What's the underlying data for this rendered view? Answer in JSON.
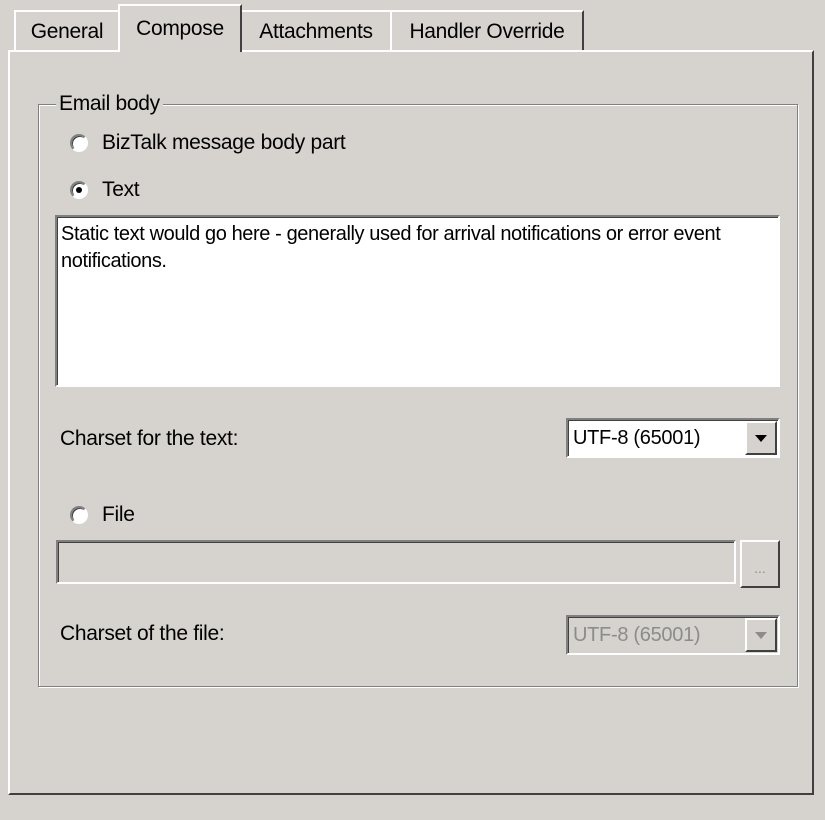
{
  "tabs": [
    "General",
    "Compose",
    "Attachments",
    "Handler Override"
  ],
  "active_tab": "Compose",
  "group": {
    "legend": "Email body",
    "radio_biztalk": "BizTalk message body part",
    "radio_text": "Text",
    "radio_file": "File",
    "selected_radio": "Text",
    "text_value": "Static text would go here - generally used for arrival notifications or error event notifications.",
    "charset_text_label": "Charset for the text:",
    "charset_text_value": "UTF-8 (65001)",
    "file_path_value": "",
    "browse_label": "...",
    "charset_file_label": "Charset of the file:",
    "charset_file_value": "UTF-8 (65001)"
  },
  "icons": [
    "chevron-down-icon"
  ]
}
